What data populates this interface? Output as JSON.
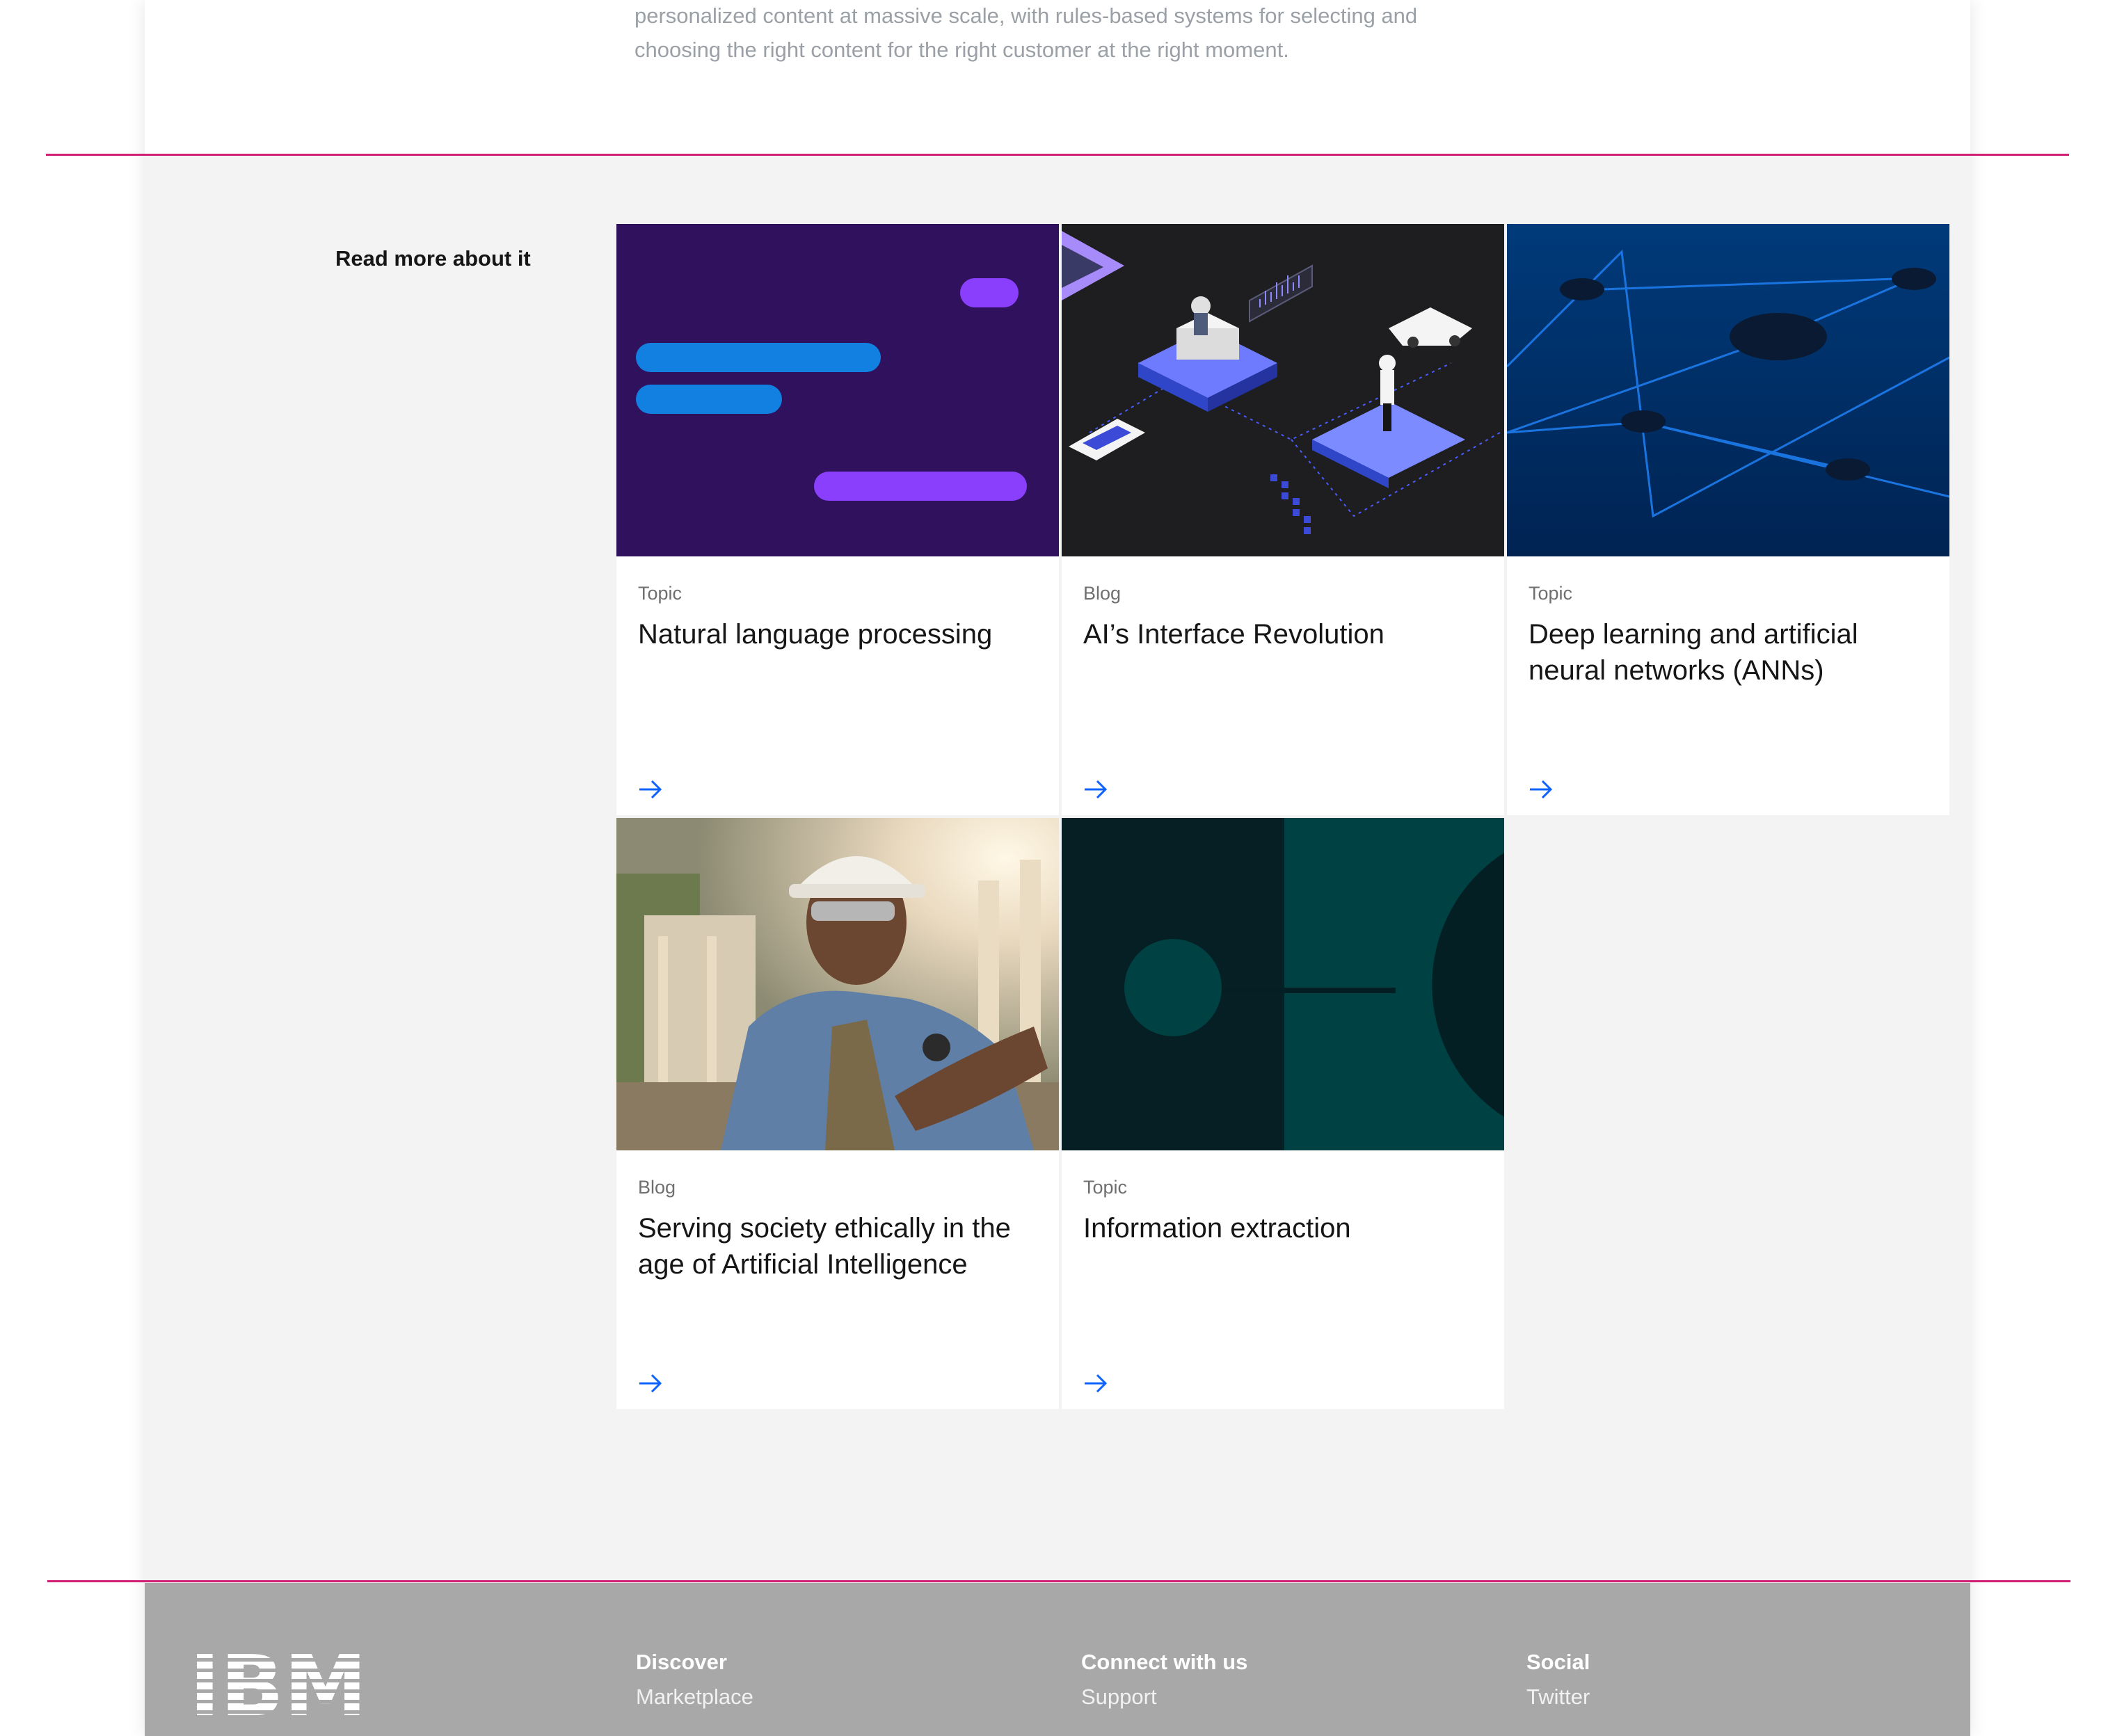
{
  "intro": {
    "text": "personalized content at massive scale, with rules-based systems for selecting and choosing the right content for the right customer at the right moment."
  },
  "read_more": {
    "title": "Read more about it",
    "cards": [
      {
        "kind": "Topic",
        "title": "Natural language processing",
        "image": "nlp-illustration"
      },
      {
        "kind": "Blog",
        "title": "AI’s Interface Revolution",
        "image": "isometric-illustration"
      },
      {
        "kind": "Topic",
        "title": "Deep learning and artificial neural networks (ANNs)",
        "image": "network-illustration"
      },
      {
        "kind": "Blog",
        "title": "Serving society ethically in the age of Artificial Intelligence",
        "image": "worker-photo"
      },
      {
        "kind": "Topic",
        "title": "Information extraction",
        "image": "geometric-illustration"
      }
    ]
  },
  "footer": {
    "logo": "IBM",
    "columns": [
      {
        "title": "Discover",
        "link": "Marketplace"
      },
      {
        "title": "Connect with us",
        "link": "Support"
      },
      {
        "title": "Social",
        "link": "Twitter"
      }
    ]
  },
  "colors": {
    "accent_line": "#d11f74",
    "link_arrow": "#0f62fe",
    "footer_bg": "#a8a8a8",
    "section_bg": "#f3f3f3"
  },
  "icons": {
    "card_link": "arrow-right-icon"
  }
}
